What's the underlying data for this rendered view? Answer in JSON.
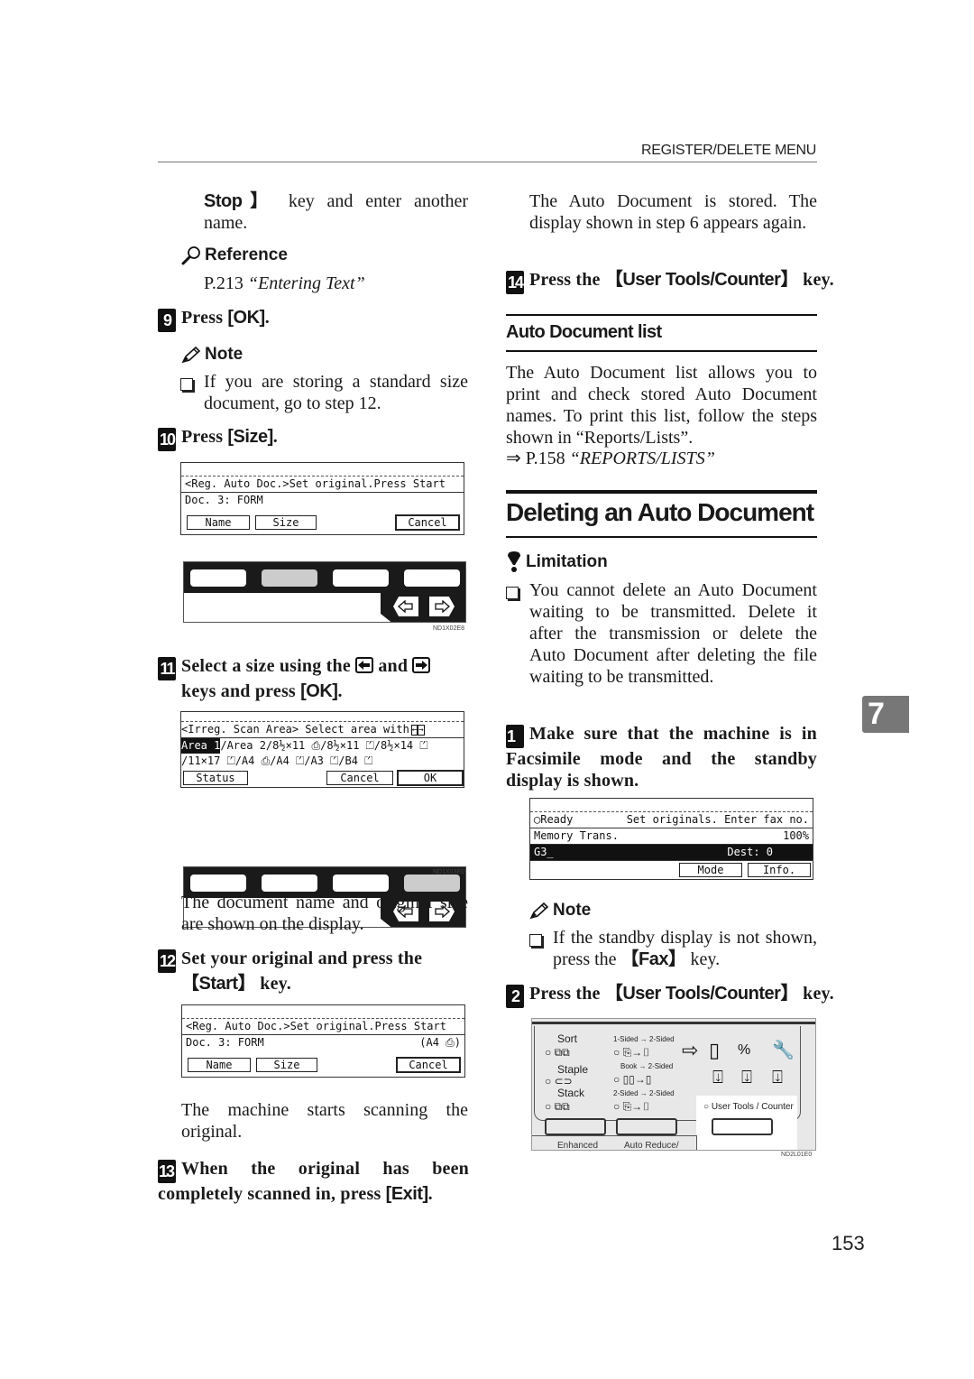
{
  "header": {
    "title": "REGISTER/DELETE MENU"
  },
  "left": {
    "continuation": {
      "key": "Stop",
      "bracket": "】",
      "text_after": " key and enter another name."
    },
    "reference": {
      "label": "Reference",
      "page": "P.213",
      "title": "“Entering Text”"
    },
    "step9": {
      "num": "9",
      "text": "Press ",
      "key": "[OK]",
      "end": "."
    },
    "note1": {
      "label": "Note",
      "items": [
        "If you are storing a standard size document, go to step 12."
      ]
    },
    "step10": {
      "num": "10",
      "text": "Press ",
      "key": "[Size]",
      "end": "."
    },
    "lcd1": {
      "line1": "<Reg. Auto Doc.>Set original.Press Start",
      "line2": "Doc. 3: FORM",
      "buttons": [
        "Name",
        "Size",
        "Cancel"
      ]
    },
    "keypanel1": {
      "code": "ND1X02E8",
      "active_key": 2
    },
    "step11": {
      "num": "11",
      "text1": "Select a size using the ",
      "left_key_icon": "left-arrow-key",
      "text2": " and ",
      "right_key_icon": "right-arrow-key",
      "text3": " keys and press ",
      "key": "[OK]",
      "end": "."
    },
    "lcd2": {
      "line1": "<Irreg. Scan Area>  Select area with",
      "line2_selected": "Area 1",
      "line2_rest": "/Area 2/8½×11 ⎙/8½×11 ⏍/8½×14 ⏍",
      "line3": "/11×17 ⏍/A4 ⎙/A4 ⏍/A3 ⏍/B4 ⏍",
      "buttons": [
        "Status",
        "Cancel",
        "OK"
      ]
    },
    "keypanel2": {
      "code": "ND1X03E0",
      "active_key": 4
    },
    "para1": "The document name and original size are shown on the display.",
    "step12": {
      "num": "12",
      "text": "Set your original and press the ",
      "key": "Start",
      "end": " key."
    },
    "lcd3": {
      "line1": "<Reg. Auto Doc.>Set original.Press Start",
      "line2": "Doc. 3: FORM",
      "line2_right": "(A4 ⎙)",
      "buttons": [
        "Name",
        "Size",
        "Cancel"
      ]
    },
    "para2": "The machine starts scanning the original.",
    "step13": {
      "num": "13",
      "text": "When the original has been completely scanned in, press ",
      "key": "[Exit]",
      "end": "."
    }
  },
  "right": {
    "para1": "The Auto Document is stored. The display shown in step 6 appears again.",
    "step14": {
      "num": "14",
      "text": "Press the ",
      "key": "User Tools/Counter",
      "end": " key."
    },
    "subsection": "Auto Document list",
    "para2": "The Auto Document list allows you to print and check stored Auto Document names. To print this list, follow the steps shown in “Reports/Lists”.",
    "xref": {
      "arrow": "⇒",
      "page": "P.158",
      "title": "“REPORTS/LISTS”"
    },
    "section_title": "Deleting an Auto Document",
    "limitation": {
      "label": "Limitation",
      "items": [
        "You cannot delete an Auto Document waiting to be transmitted. Delete it after the transmission or delete the Auto Document after deleting the file waiting to be transmitted."
      ]
    },
    "step1": {
      "num": "1",
      "text": "Make sure that the machine is in Facsimile mode and the standby display is shown."
    },
    "lcd4": {
      "line1_left": "Ready",
      "line1_right": "Set originals. Enter fax no.",
      "line2_left": "Memory Trans.",
      "line2_right": "100%",
      "line3_left": "G3_",
      "line3_right": "Dest:  0",
      "buttons": [
        "Mode",
        "Info."
      ]
    },
    "note2": {
      "label": "Note",
      "items_pre": "If the standby display is not shown, press the ",
      "key": "Fax",
      "items_post": " key."
    },
    "step2": {
      "num": "2",
      "text": "Press the ",
      "key": "User Tools/Counter",
      "end": " key."
    },
    "control_panel": {
      "code": "ND2L01E0",
      "finisher": [
        "Sort",
        "Staple",
        "Stack"
      ],
      "duplex": [
        "1-Sided → 2-Sided",
        "Book → 2-Sided",
        "2-Sided → 2-Sided"
      ],
      "user_tools_label": "User Tools / Counter",
      "bottom_labels": [
        "Enhanced",
        "Auto Reduce/"
      ]
    }
  },
  "chapter_tab": "7",
  "page_number": "153"
}
